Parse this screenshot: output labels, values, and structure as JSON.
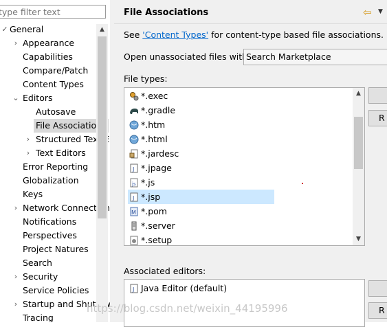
{
  "filter": {
    "placeholder": "type filter text"
  },
  "tree": [
    {
      "label": "General",
      "toggle": "✓",
      "level": 0,
      "row": 0
    },
    {
      "label": "Appearance",
      "toggle": "›",
      "level": 1,
      "row": 1
    },
    {
      "label": "Capabilities",
      "toggle": "",
      "level": 1,
      "row": 2
    },
    {
      "label": "Compare/Patch",
      "toggle": "",
      "level": 1,
      "row": 3
    },
    {
      "label": "Content Types",
      "toggle": "",
      "level": 1,
      "row": 4
    },
    {
      "label": "Editors",
      "toggle": "⌄",
      "level": 1,
      "row": 5
    },
    {
      "label": "Autosave",
      "toggle": "",
      "level": 2,
      "row": 6
    },
    {
      "label": "File Associations",
      "toggle": "",
      "level": 2,
      "row": 7,
      "selected": true
    },
    {
      "label": "Structured Text Editors",
      "toggle": "›",
      "level": 2,
      "row": 8
    },
    {
      "label": "Text Editors",
      "toggle": "›",
      "level": 2,
      "row": 9
    },
    {
      "label": "Error Reporting",
      "toggle": "",
      "level": 1,
      "row": 10
    },
    {
      "label": "Globalization",
      "toggle": "",
      "level": 1,
      "row": 11
    },
    {
      "label": "Keys",
      "toggle": "",
      "level": 1,
      "row": 12
    },
    {
      "label": "Network Connections",
      "toggle": "›",
      "level": 1,
      "row": 13
    },
    {
      "label": "Notifications",
      "toggle": "",
      "level": 1,
      "row": 14
    },
    {
      "label": "Perspectives",
      "toggle": "",
      "level": 1,
      "row": 15
    },
    {
      "label": "Project Natures",
      "toggle": "",
      "level": 1,
      "row": 16
    },
    {
      "label": "Search",
      "toggle": "",
      "level": 1,
      "row": 17
    },
    {
      "label": "Security",
      "toggle": "›",
      "level": 1,
      "row": 18
    },
    {
      "label": "Service Policies",
      "toggle": "",
      "level": 1,
      "row": 19
    },
    {
      "label": "Startup and Shutdown",
      "toggle": "›",
      "level": 1,
      "row": 20
    },
    {
      "label": "Tracing",
      "toggle": "",
      "level": 1,
      "row": 21
    }
  ],
  "page": {
    "title": "File Associations",
    "see_prefix": "See ",
    "see_link": "'Content Types'",
    "see_suffix": " for content-type based file associations.",
    "open_label": "Open unassociated files with:",
    "open_value": "Search Marketplace",
    "file_types_label": "File types:",
    "associated_label": "Associated editors:"
  },
  "file_types": [
    {
      "name": "*.exec",
      "icon": "gears-icon"
    },
    {
      "name": "*.gradle",
      "icon": "gradle-elephant-icon"
    },
    {
      "name": "*.htm",
      "icon": "web-globe-icon"
    },
    {
      "name": "*.html",
      "icon": "web-globe-icon"
    },
    {
      "name": "*.jardesc",
      "icon": "jar-description-icon"
    },
    {
      "name": "*.jpage",
      "icon": "java-file-icon"
    },
    {
      "name": "*.js",
      "icon": "javascript-file-icon"
    },
    {
      "name": "*.jsp",
      "icon": "java-file-icon",
      "selected": true
    },
    {
      "name": "*.pom",
      "icon": "maven-file-icon"
    },
    {
      "name": "*.server",
      "icon": "server-file-icon"
    },
    {
      "name": "*.setup",
      "icon": "setup-file-icon"
    }
  ],
  "associated_editors": [
    {
      "name": "Java Editor (default)",
      "icon": "java-file-icon"
    }
  ],
  "side_buttons": [
    {
      "label": ""
    },
    {
      "label": "R"
    },
    {
      "label": ""
    },
    {
      "label": "R"
    }
  ],
  "watermark": "https://blog.csdn.net/weixin_44195996"
}
